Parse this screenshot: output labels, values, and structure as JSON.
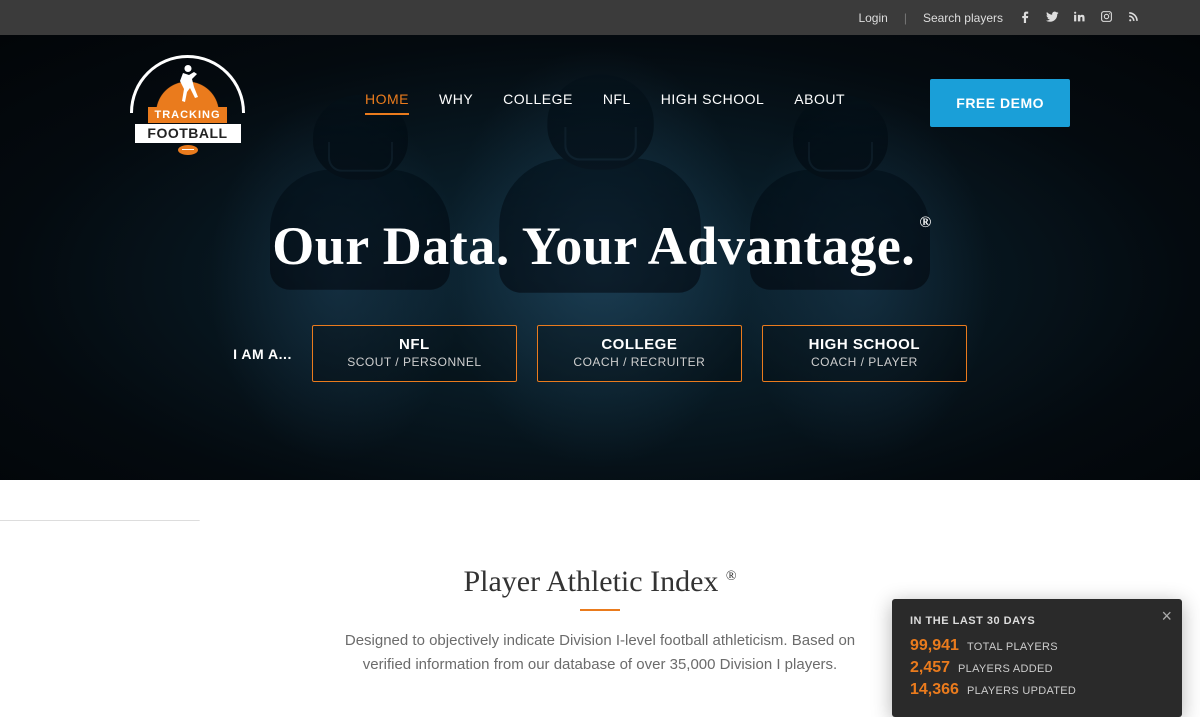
{
  "topbar": {
    "login": "Login",
    "search": "Search players"
  },
  "logo": {
    "line1": "TRACKING",
    "line2": "FOOTBALL"
  },
  "nav": {
    "items": [
      "HOME",
      "WHY",
      "COLLEGE",
      "NFL",
      "HIGH SCHOOL",
      "ABOUT"
    ],
    "activeIndex": 0,
    "demo": "FREE DEMO"
  },
  "hero": {
    "title": "Our Data. Your Advantage.",
    "reg": "®",
    "roleLabel": "I AM A...",
    "roles": [
      {
        "title": "NFL",
        "sub": "SCOUT / PERSONNEL"
      },
      {
        "title": "COLLEGE",
        "sub": "COACH / RECRUITER"
      },
      {
        "title": "HIGH SCHOOL",
        "sub": "COACH / PLAYER"
      }
    ]
  },
  "section2": {
    "title": "Player Athletic Index ",
    "reg": "®",
    "body": "Designed to objectively indicate Division I-level football athleticism. Based on verified information from our database of over 35,000 Division I players."
  },
  "stats": {
    "header": "IN THE LAST 30 DAYS",
    "rows": [
      {
        "num": "99,941",
        "label": "TOTAL PLAYERS"
      },
      {
        "num": "2,457",
        "label": "PLAYERS ADDED"
      },
      {
        "num": "14,366",
        "label": "PLAYERS UPDATED"
      }
    ]
  }
}
